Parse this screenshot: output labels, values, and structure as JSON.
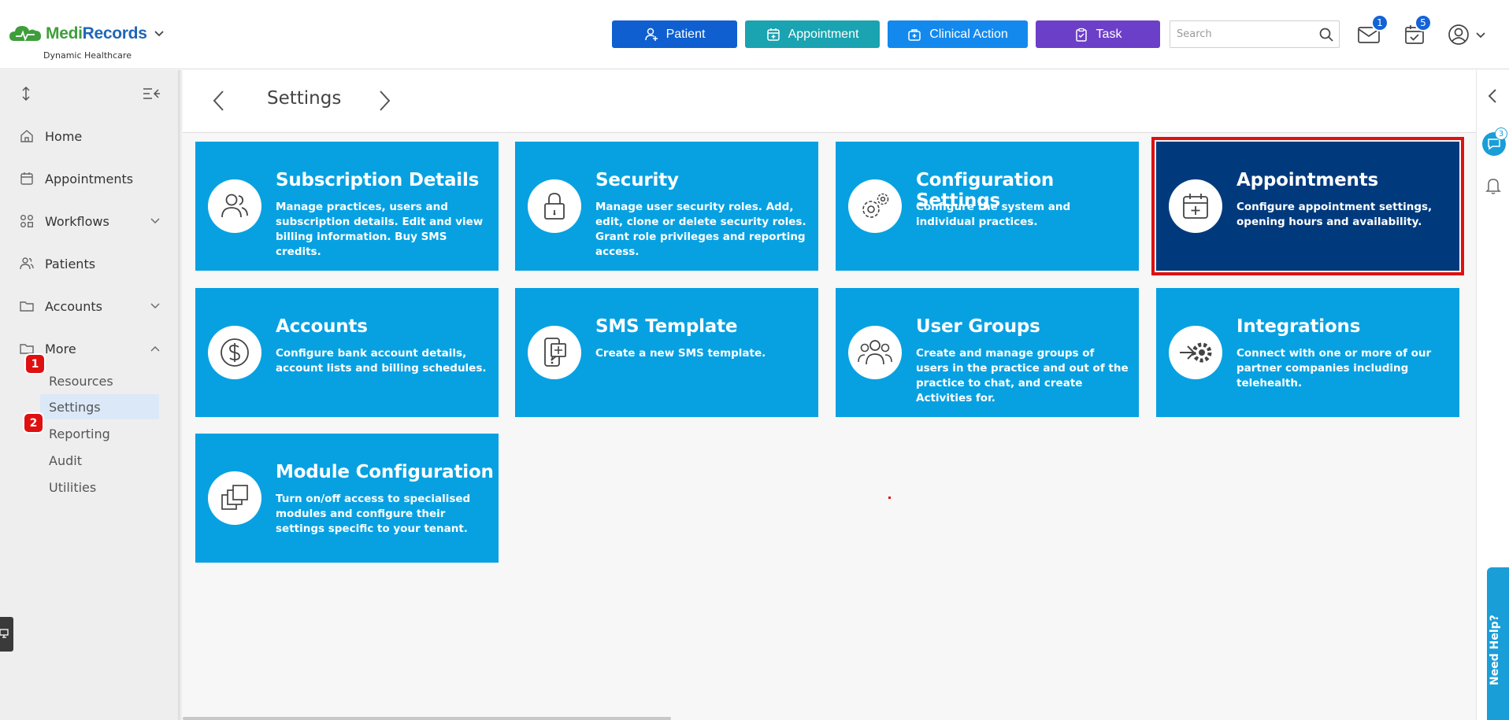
{
  "header": {
    "logo": {
      "medi": "Medi",
      "records": "Records",
      "subtitle": "Dynamic Healthcare"
    },
    "buttons": {
      "patient": "Patient",
      "appointment": "Appointment",
      "clinical_action": "Clinical Action",
      "task": "Task"
    },
    "search": {
      "placeholder": "Search",
      "value": ""
    },
    "mail_badge": "1",
    "tasks_badge": "5"
  },
  "sidebar": {
    "items": [
      {
        "label": "Home",
        "icon": "home-icon"
      },
      {
        "label": "Appointments",
        "icon": "calendar-icon"
      },
      {
        "label": "Workflows",
        "icon": "workflow-icon"
      },
      {
        "label": "Patients",
        "icon": "users-icon"
      },
      {
        "label": "Accounts",
        "icon": "folder-icon"
      },
      {
        "label": "More",
        "icon": "folder-icon"
      }
    ],
    "sub_items": [
      "Resources",
      "Settings",
      "Reporting",
      "Audit",
      "Utilities"
    ],
    "active_sub": "Settings",
    "steps": [
      "1",
      "2"
    ]
  },
  "page": {
    "title": "Settings"
  },
  "cards": [
    {
      "title": "Subscription Details",
      "desc": "Manage practices, users and subscription details. Edit and view billing information. Buy SMS credits.",
      "icon": "users-icon"
    },
    {
      "title": "Security",
      "desc": "Manage user security roles. Add, edit, clone or delete security roles. Grant role privileges and reporting access.",
      "icon": "lock-icon"
    },
    {
      "title": "Configuration Settings",
      "desc": "Configure the system and individual practices.",
      "icon": "gears-icon"
    },
    {
      "title": "Appointments",
      "desc": "Configure appointment settings, opening hours and availability.",
      "icon": "calendar-plus-icon"
    },
    {
      "title": "Accounts",
      "desc": "Configure bank account details, account lists and billing schedules.",
      "icon": "dollar-icon"
    },
    {
      "title": "SMS Template",
      "desc": "Create a new SMS template.",
      "icon": "phone-template-icon"
    },
    {
      "title": "User Groups",
      "desc": "Create and manage groups of users in the practice and out of the practice to chat, and create Activities for.",
      "icon": "user-group-icon"
    },
    {
      "title": "Integrations",
      "desc": "Connect with one or more of our partner companies including telehealth.",
      "icon": "integration-icon"
    },
    {
      "title": "Module Configuration",
      "desc": "Turn on/off access to specialised modules and configure their settings specific to your tenant.",
      "icon": "modules-icon"
    }
  ],
  "right_rail": {
    "chat_badge": "3",
    "need_help": "Need Help?"
  },
  "colors": {
    "card": "#07a1e2",
    "card_selected": "#003a7d",
    "highlight": "#e01010"
  }
}
